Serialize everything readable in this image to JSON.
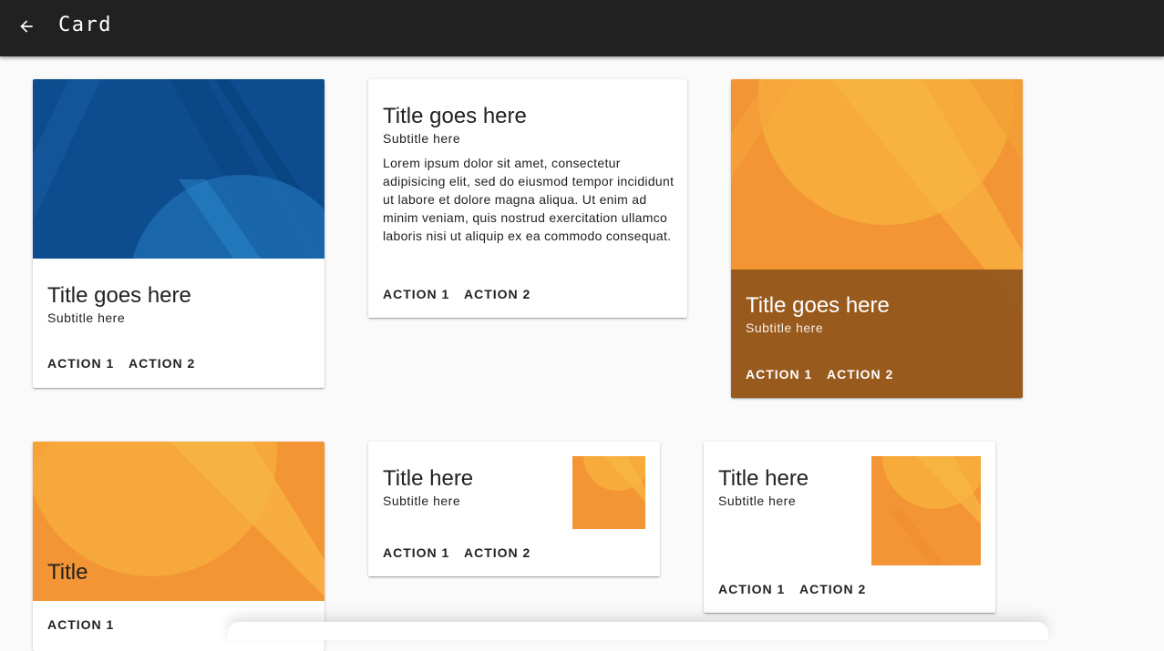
{
  "appbar": {
    "title": "Card",
    "back_icon": "arrow-back-icon"
  },
  "colors": {
    "appbar": "#212121",
    "blue_media": "#0d4c8f",
    "orange_media": "#f6a03a",
    "overlay_brown": "#91551c"
  },
  "cards": [
    {
      "id": "card-media-top",
      "title": "Title goes here",
      "subtitle": "Subtitle here",
      "actions": [
        "ACTION 1",
        "ACTION 2"
      ]
    },
    {
      "id": "card-text",
      "title": "Title goes here",
      "subtitle": "Subtitle here",
      "body": "Lorem ipsum dolor sit amet, consectetur adipisicing elit, sed do eiusmod tempor incididunt ut labore et dolore magna aliqua. Ut enim ad minim veniam, quis nostrud exercitation ullamco laboris nisi ut aliquip ex ea commodo consequat.",
      "actions": [
        "ACTION 1",
        "ACTION 2"
      ]
    },
    {
      "id": "card-overlay",
      "title": "Title goes here",
      "subtitle": "Subtitle here",
      "actions": [
        "ACTION 1",
        "ACTION 2"
      ]
    },
    {
      "id": "card-media-title",
      "title": "Title",
      "actions": [
        "ACTION 1"
      ]
    },
    {
      "id": "card-small-thumb",
      "title": "Title here",
      "subtitle": "Subtitle here",
      "actions": [
        "ACTION 1",
        "ACTION 2"
      ]
    },
    {
      "id": "card-large-thumb",
      "title": "Title here",
      "subtitle": "Subtitle here",
      "actions": [
        "ACTION 1",
        "ACTION 2"
      ]
    }
  ]
}
